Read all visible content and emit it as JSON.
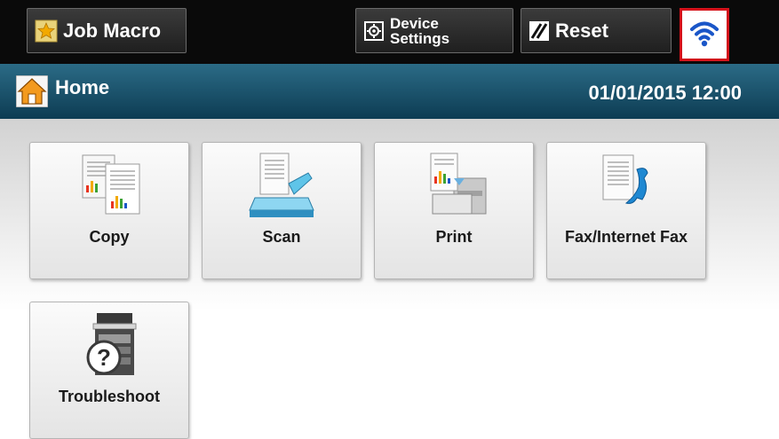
{
  "toolbar": {
    "job_macro_label": "Job Macro",
    "device_settings_label": "Device\nSettings",
    "reset_label": "Reset",
    "wifi_icon": "wifi-icon"
  },
  "header": {
    "title": "Home",
    "datetime": "01/01/2015 12:00"
  },
  "tiles": [
    {
      "label": "Copy",
      "icon": "copy-icon"
    },
    {
      "label": "Scan",
      "icon": "scan-icon"
    },
    {
      "label": "Print",
      "icon": "print-icon"
    },
    {
      "label": "Fax/Internet Fax",
      "icon": "fax-icon"
    },
    {
      "label": "Troubleshoot",
      "icon": "troubleshoot-icon"
    }
  ],
  "colors": {
    "toolbar_bg": "#0a0a0a",
    "titlebar_bg": "#0d3c53",
    "wifi_highlight": "#d4121b",
    "wifi_blue": "#1a56c8"
  }
}
